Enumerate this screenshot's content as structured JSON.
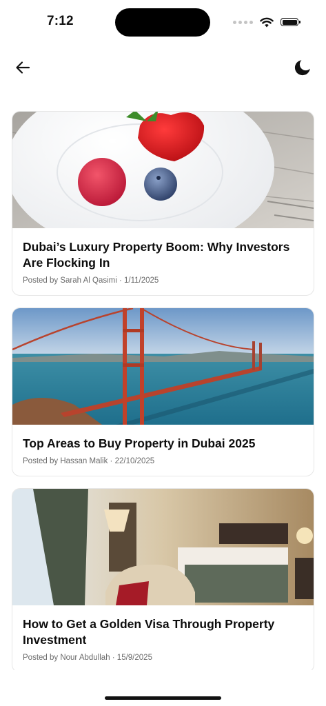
{
  "status_bar": {
    "time": "7:12"
  },
  "nav": {
    "back_icon": "arrow-left-icon",
    "theme_icon": "moon-icon"
  },
  "posts": [
    {
      "title": "Dubai’s Luxury Property Boom: Why Investors Are Flocking In",
      "meta": "Posted by Sarah Al Qasimi · 1/11/2025",
      "image": "berries-on-plate-photo"
    },
    {
      "title": "Top Areas to Buy Property in Dubai 2025",
      "meta": "Posted by Hassan Malik · 22/10/2025",
      "image": "golden-gate-bridge-photo"
    },
    {
      "title": "How to Get a Golden Visa Through Property Investment",
      "meta": "Posted by Nour Abdullah · 15/9/2025",
      "image": "hotel-bedroom-photo"
    }
  ]
}
